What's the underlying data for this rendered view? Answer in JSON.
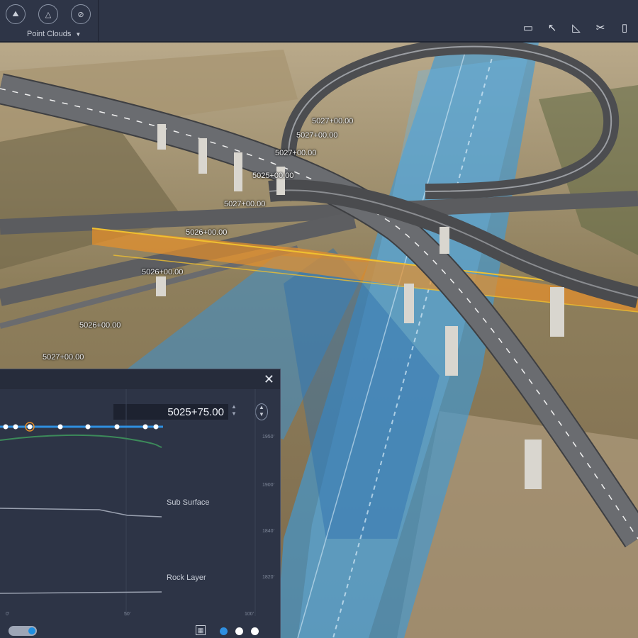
{
  "toolbar": {
    "tools": [
      {
        "icon": "terrain-xyz-icon"
      },
      {
        "icon": "terrain-triangle-icon"
      },
      {
        "icon": "terrain-hatch-icon"
      }
    ],
    "dropdown_label": "Point Clouds",
    "right_tools": [
      {
        "icon": "display-settings-icon",
        "glyph": "▭"
      },
      {
        "icon": "select-arrow-icon",
        "glyph": "↖"
      },
      {
        "icon": "measure-angle-icon",
        "glyph": "◺"
      },
      {
        "icon": "clip-tool-icon",
        "glyph": "✂"
      },
      {
        "icon": "section-tool-icon",
        "glyph": "▯"
      }
    ]
  },
  "stations": [
    "5027+00.00",
    "5027+00.00",
    "5027+00.00",
    "5025+00.00",
    "5027+00.00",
    "5026+00.00",
    "5026+00.00",
    "5026+00.00",
    "5027+00.00"
  ],
  "profile_panel": {
    "station_value": "5025+75.00",
    "layers": [
      "Sub Surface",
      "Rock Layer"
    ],
    "elevation_ticks": [
      "1950'",
      "1900'",
      "1840'",
      "1820'"
    ],
    "x_ticks": [
      "0'",
      "50'",
      "100'"
    ]
  },
  "colors": {
    "toolbar_bg": "#2e3547",
    "panel_bg": "#2d3446",
    "corridor_blue": "#3f9ad6",
    "alignment_orange": "#e8902a",
    "alignment_yellow": "#f0c030",
    "profile_blue": "#2f8fe0",
    "ground_green": "#3c8a5a"
  }
}
